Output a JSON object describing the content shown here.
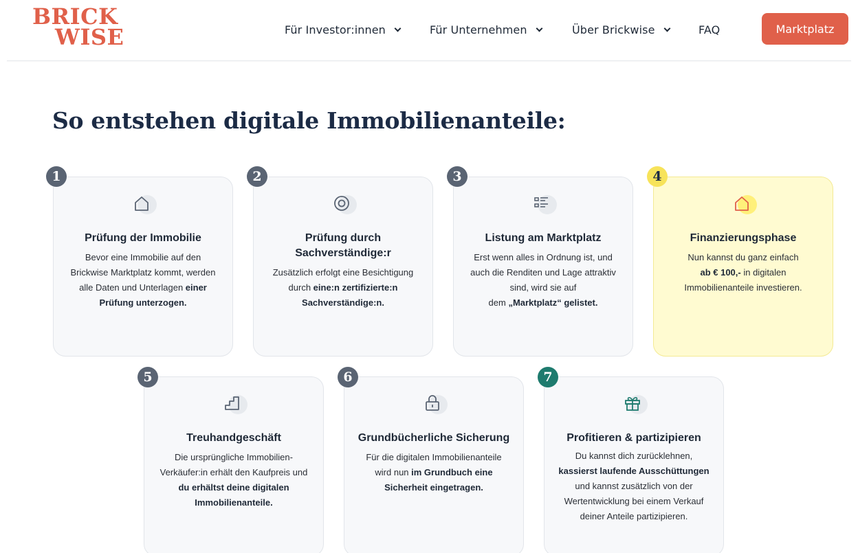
{
  "header": {
    "logo_line1": "BRICK",
    "logo_line2": "WISE",
    "nav": [
      "Für Investor:innen",
      "Für Unternehmen",
      "Über Brickwise",
      "FAQ"
    ],
    "cta_label": "Marktplatz"
  },
  "colors": {
    "brand": "#e0604a",
    "headline": "#1c2b45",
    "highlight_card": "#fffbd1",
    "badge_default": "#5a6473",
    "badge_highlight": "#f7e35a",
    "badge_final": "#1e7b6e"
  },
  "headline": "So entstehen digitale Immobilienanteile:",
  "steps": [
    {
      "number": "1",
      "icon": "house-icon",
      "title": "Prüfung der Immobilie",
      "body": [
        "Bevor eine Immobilie auf den",
        "Brickwise Marktplatz kommt, werden",
        "alle Daten und Unterlagen ",
        "einer",
        "Prüfung unterzogen."
      ]
    },
    {
      "number": "2",
      "icon": "eye-icon",
      "title_line1": "Prüfung durch",
      "title_line2": "Sachverständige:r",
      "body": [
        "Zusätzlich erfolgt eine Besichtigung",
        "durch ",
        "eine:n zertifizierte:n",
        "Sachverständige:n."
      ]
    },
    {
      "number": "3",
      "icon": "list-icon",
      "title": "Listung am Marktplatz",
      "body": [
        "Erst wenn alles in Ordnung ist, und",
        "auch die Renditen und Lage attraktiv",
        "sind, wird sie auf",
        "dem ",
        "„Marktplatz“ gelistet."
      ]
    },
    {
      "number": "4",
      "icon": "house-icon",
      "title": "Finanzierungsphase",
      "body": [
        "Nun kannst du ganz einfach",
        "ab € 100,-",
        " in digitalen",
        "Immobilienanteile investieren."
      ]
    },
    {
      "number": "5",
      "icon": "stairs-icon",
      "title": "Treuhandgeschäft",
      "body": [
        "Die ursprüngliche Immobilien-",
        "Verkäufer:in erhält den Kaufpreis und",
        "du erhältst deine digitalen",
        "Immobilienanteile."
      ]
    },
    {
      "number": "6",
      "icon": "lock-icon",
      "title": "Grundbücherliche Sicherung",
      "body": [
        "Für die digitalen Immobilienanteile",
        "wird nun ",
        "im Grundbuch eine",
        "Sicherheit eingetragen."
      ]
    },
    {
      "number": "7",
      "icon": "gift-icon",
      "title": "Profitieren & partizipieren",
      "body": [
        "Du kannst dich zurücklehnen,",
        "kassierst laufende Ausschüttungen",
        "und kannst zusätzlich von der",
        "Wertentwicklung bei einem Verkauf",
        "deiner Anteile partizipieren."
      ]
    }
  ]
}
